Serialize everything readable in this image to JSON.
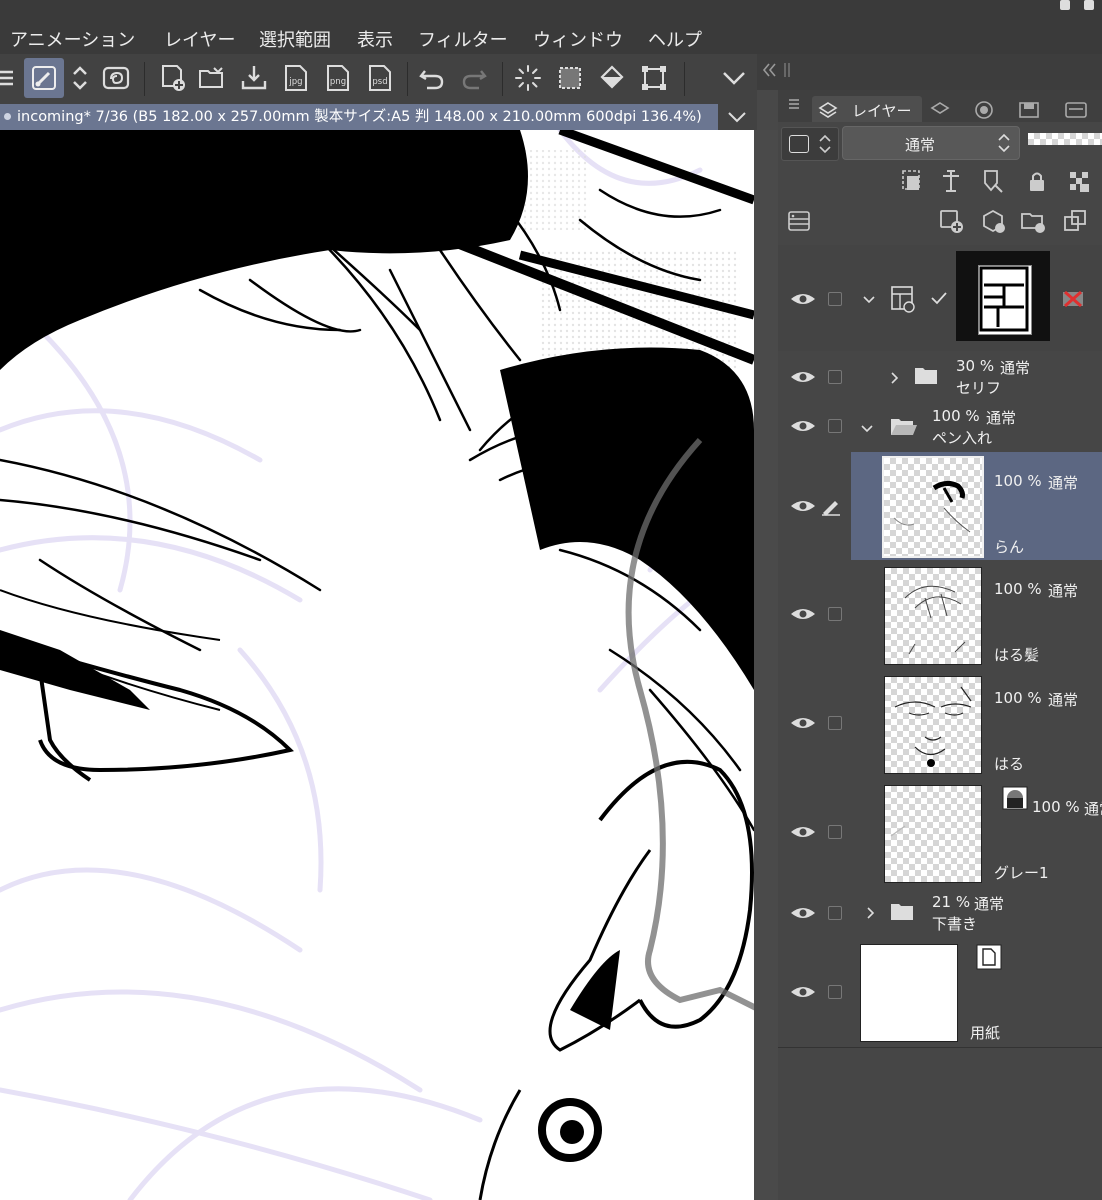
{
  "menu": {
    "items": [
      "アニメーション",
      "レイヤー",
      "選択範囲",
      "表示",
      "フィルター",
      "ウィンドウ",
      "ヘルプ"
    ]
  },
  "toolbar": {
    "icons": [
      "menu-icon",
      "brush-icon",
      "stepper-icon",
      "spiral-icon",
      "new-page-icon",
      "open-folder-icon",
      "import-icon",
      "jpg-export-icon",
      "png-export-icon",
      "psd-export-icon",
      "undo-icon",
      "redo-icon",
      "busy-icon",
      "selection-icon",
      "fill-icon",
      "transform-icon",
      "chevron-down-icon"
    ],
    "jpg": "jpg",
    "png": "png",
    "psd": "psd"
  },
  "document": {
    "tab_title": "incoming* 7/36 (B5 182.00 x 257.00mm 製本サイズ:A5 判 148.00 x 210.00mm 600dpi 136.4%)"
  },
  "panel": {
    "tab_label": "レイヤー",
    "blend_mode": "通常"
  },
  "layers": [
    {
      "kind": "frame",
      "name": "",
      "opacity": ""
    },
    {
      "kind": "folder",
      "collapsed": true,
      "opacity": "30 %",
      "mode": "通常",
      "name": "セリフ"
    },
    {
      "kind": "folder",
      "collapsed": false,
      "opacity": "100 %",
      "mode": "通常",
      "name": "ペン入れ"
    },
    {
      "kind": "layer",
      "selected": true,
      "opacity": "100 %",
      "mode": "通常",
      "name": "らん"
    },
    {
      "kind": "layer",
      "opacity": "100 %",
      "mode": "通常",
      "name": "はる髪"
    },
    {
      "kind": "layer",
      "opacity": "100 %",
      "mode": "通常",
      "name": "はる"
    },
    {
      "kind": "layer",
      "opacity": "100 %",
      "mode": "通常",
      "name": "グレー1"
    },
    {
      "kind": "folder",
      "collapsed": true,
      "opacity": "21 %",
      "mode": "通常",
      "name": "下書き"
    },
    {
      "kind": "paper",
      "name": "用紙"
    }
  ],
  "colors": {
    "accent_selected": "#5c6782",
    "doc_tab": "#6b7691",
    "sketch_lavender": "#e6e1f6",
    "panel_bg": "#464646"
  }
}
